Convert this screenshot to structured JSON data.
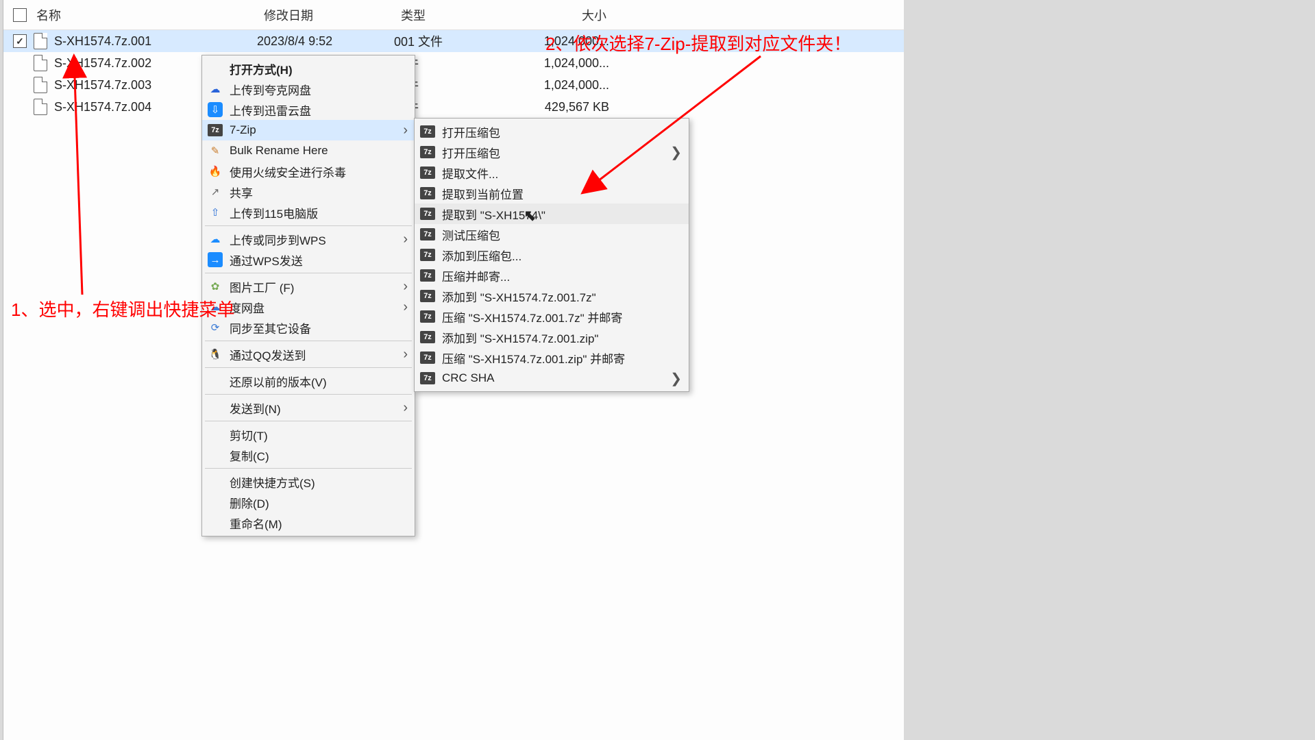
{
  "headers": {
    "name": "名称",
    "date": "修改日期",
    "type": "类型",
    "size": "大小"
  },
  "rows": [
    {
      "name": "S-XH1574.7z.001",
      "date": "2023/8/4 9:52",
      "type": "001 文件",
      "size": "1,024,000...",
      "checked": true,
      "selected": true
    },
    {
      "name": "S-XH1574.7z.002",
      "date": "",
      "type": "文件",
      "size": "1,024,000..."
    },
    {
      "name": "S-XH1574.7z.003",
      "date": "",
      "type": "文件",
      "size": "1,024,000..."
    },
    {
      "name": "S-XH1574.7z.004",
      "date": "",
      "type": "文件",
      "size": "429,567 KB"
    }
  ],
  "ctx": {
    "open_with": "打开方式(H)",
    "quark": "上传到夸克网盘",
    "xunlei": "上传到迅雷云盘",
    "sevenzip": "7-Zip",
    "bulk_rename": "Bulk Rename Here",
    "huorong": "使用火绒安全进行杀毒",
    "share": "共享",
    "upload115": "上传到115电脑版",
    "wps_upload": "上传或同步到WPS",
    "wps_send": "通过WPS发送",
    "pic_factory": "图片工厂 (F)",
    "baidu": "度网盘",
    "sync_other": "同步至其它设备",
    "qq_send": "通过QQ发送到",
    "restore": "还原以前的版本(V)",
    "send_to": "发送到(N)",
    "cut": "剪切(T)",
    "copy": "复制(C)",
    "shortcut": "创建快捷方式(S)",
    "delete": "删除(D)",
    "rename": "重命名(M)"
  },
  "sub": {
    "open1": "打开压缩包",
    "open2": "打开压缩包",
    "extract_files": "提取文件...",
    "extract_here": "提取到当前位置",
    "extract_to": "提取到 \"S-XH1574\\\"",
    "test": "测试压缩包",
    "add_to": "添加到压缩包...",
    "compress_email": "压缩并邮寄...",
    "add_7z": "添加到 \"S-XH1574.7z.001.7z\"",
    "compress_7z_email": "压缩 \"S-XH1574.7z.001.7z\" 并邮寄",
    "add_zip": "添加到 \"S-XH1574.7z.001.zip\"",
    "compress_zip_email": "压缩 \"S-XH1574.7z.001.zip\" 并邮寄",
    "crc": "CRC SHA"
  },
  "anno": {
    "step1": "1、选中，右键调出快捷菜单",
    "step2": "2、依次选择7-Zip-提取到对应文件夹！"
  }
}
